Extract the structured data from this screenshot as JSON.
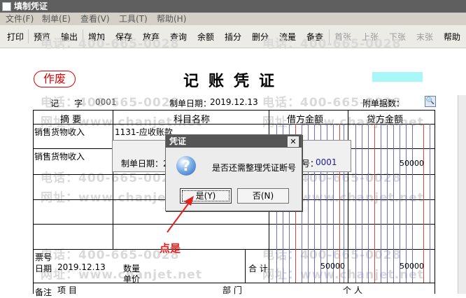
{
  "window": {
    "title": "填制凭证"
  },
  "menu": [
    "文件(F)",
    "制单(E)",
    "查看(V)",
    "工具(T)",
    "帮助(H)"
  ],
  "toolbar": {
    "enabled": [
      "打印",
      "预览",
      "输出",
      "增加",
      "保存",
      "放弃",
      "查询",
      "余额",
      "插分",
      "删分",
      "流量",
      "备查"
    ],
    "disabled": [
      "首张",
      "上张",
      "下张",
      "末张"
    ],
    "help": "帮助"
  },
  "voucher": {
    "stamp": "作废",
    "title": "记账凭证",
    "type_label": "记",
    "number_label": "字",
    "number": "0001",
    "date_label": "制单日期：",
    "date": "2019.12.13",
    "attach_label": "附单据数：",
    "columns": {
      "summary": "摘 要",
      "account": "科目名称",
      "debit": "借方金额",
      "credit": "贷方金额"
    },
    "rows": [
      {
        "summary": "销售货物收入",
        "account": "1131-应收账款",
        "debit": "",
        "credit": ""
      },
      {
        "summary": "销售货物收入",
        "account": "",
        "debit": "",
        "credit": "50000"
      }
    ],
    "footer": {
      "ticket_no_label": "票号",
      "date_label": "日期",
      "date": "2019.12.13",
      "qty_label": "数量",
      "price_label": "单价",
      "total_label": "合 计",
      "debit_total": "50000",
      "credit_total": "50000",
      "note_label": "备注",
      "project_label": "项 目",
      "dept_label": "部 门",
      "person_label": "个 人"
    }
  },
  "watermark": {
    "phone": "电话：400-665-0028",
    "site": "网址：www.chanjet.net"
  },
  "bg_dialog": {
    "date_label": "制单日期：2",
    "number_label": "号：",
    "number": "0001"
  },
  "dialog": {
    "title": "凭证",
    "message": "是否还需整理凭证断号",
    "yes": "是(Y)",
    "no": "否(N)",
    "close": "✕"
  },
  "annotation": {
    "label": "点是",
    "color": "#e52020"
  },
  "colors": {
    "titlebar": "#5f5f5f",
    "stamp": "#dd0000",
    "grid_blue": "#6e6ec8",
    "grid_red": "#dd4444"
  }
}
